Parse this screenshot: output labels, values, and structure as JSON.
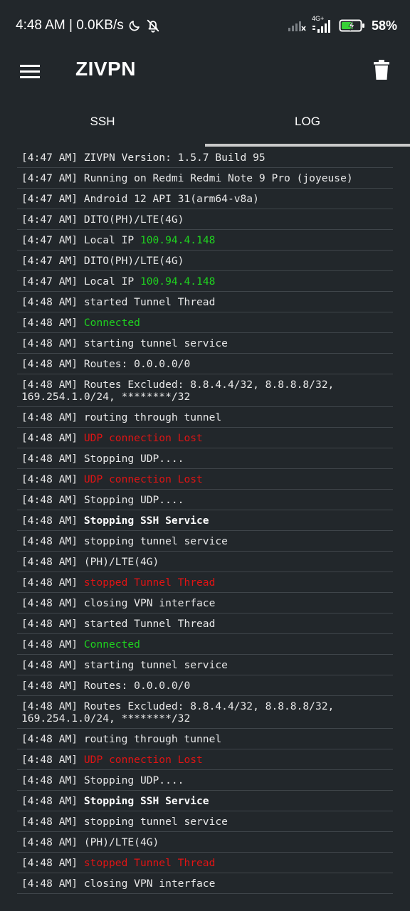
{
  "status_bar": {
    "time_text": "4:48 AM | 0.0KB/s",
    "network_label": "4G+",
    "battery_percent": "58%"
  },
  "toolbar": {
    "title": "ZIVPN"
  },
  "tabs": [
    {
      "label": "SSH",
      "active": false
    },
    {
      "label": "LOG",
      "active": true
    }
  ],
  "colors": {
    "background": "#22272b",
    "green": "#1fd31f",
    "red": "#e01414",
    "divider": "#3f454a"
  },
  "log": [
    {
      "ts": "[4:47 AM]",
      "parts": [
        {
          "t": " ZIVPN Version: 1.5.7 Build 95",
          "s": ""
        }
      ]
    },
    {
      "ts": "[4:47 AM]",
      "parts": [
        {
          "t": " Running on Redmi Redmi Note 9 Pro (joyeuse)",
          "s": ""
        }
      ]
    },
    {
      "ts": "[4:47 AM]",
      "parts": [
        {
          "t": " Android 12 API 31(arm64-v8a)",
          "s": ""
        }
      ]
    },
    {
      "ts": "[4:47 AM]",
      "parts": [
        {
          "t": " DITO(PH)/LTE(4G)",
          "s": ""
        }
      ]
    },
    {
      "ts": "[4:47 AM]",
      "parts": [
        {
          "t": " Local IP ",
          "s": ""
        },
        {
          "t": "100.94.4.148",
          "s": "green"
        }
      ]
    },
    {
      "ts": "[4:47 AM]",
      "parts": [
        {
          "t": " DITO(PH)/LTE(4G)",
          "s": ""
        }
      ]
    },
    {
      "ts": "[4:47 AM]",
      "parts": [
        {
          "t": " Local IP ",
          "s": ""
        },
        {
          "t": "100.94.4.148",
          "s": "green"
        }
      ]
    },
    {
      "ts": "[4:48 AM]",
      "parts": [
        {
          "t": " started Tunnel Thread",
          "s": ""
        }
      ]
    },
    {
      "ts": "[4:48 AM]",
      "parts": [
        {
          "t": " ",
          "s": ""
        },
        {
          "t": "Connected",
          "s": "green"
        }
      ]
    },
    {
      "ts": "[4:48 AM]",
      "parts": [
        {
          "t": " starting tunnel service",
          "s": ""
        }
      ]
    },
    {
      "ts": "[4:48 AM]",
      "parts": [
        {
          "t": " Routes: 0.0.0.0/0",
          "s": ""
        }
      ]
    },
    {
      "ts": "[4:48 AM]",
      "parts": [
        {
          "t": " Routes Excluded: 8.8.4.4/32, 8.8.8.8/32, 169.254.1.0/24, ********/32",
          "s": ""
        }
      ]
    },
    {
      "ts": "[4:48 AM]",
      "parts": [
        {
          "t": " routing through tunnel",
          "s": ""
        }
      ]
    },
    {
      "ts": "[4:48 AM]",
      "parts": [
        {
          "t": " ",
          "s": ""
        },
        {
          "t": "UDP connection Lost",
          "s": "red"
        }
      ]
    },
    {
      "ts": "[4:48 AM]",
      "parts": [
        {
          "t": " Stopping UDP....",
          "s": ""
        }
      ]
    },
    {
      "ts": "[4:48 AM]",
      "parts": [
        {
          "t": " ",
          "s": ""
        },
        {
          "t": "UDP connection Lost",
          "s": "red"
        }
      ]
    },
    {
      "ts": "[4:48 AM]",
      "parts": [
        {
          "t": " Stopping UDP....",
          "s": ""
        }
      ]
    },
    {
      "ts": "[4:48 AM]",
      "parts": [
        {
          "t": " ",
          "s": ""
        },
        {
          "t": "Stopping SSH Service",
          "s": "bold"
        }
      ]
    },
    {
      "ts": "[4:48 AM]",
      "parts": [
        {
          "t": " stopping tunnel service",
          "s": ""
        }
      ]
    },
    {
      "ts": "[4:48 AM]",
      "parts": [
        {
          "t": " (PH)/LTE(4G)",
          "s": ""
        }
      ]
    },
    {
      "ts": "[4:48 AM]",
      "parts": [
        {
          "t": " ",
          "s": ""
        },
        {
          "t": "stopped Tunnel Thread",
          "s": "red"
        }
      ]
    },
    {
      "ts": "[4:48 AM]",
      "parts": [
        {
          "t": " closing VPN interface",
          "s": ""
        }
      ]
    },
    {
      "ts": "[4:48 AM]",
      "parts": [
        {
          "t": " started Tunnel Thread",
          "s": ""
        }
      ]
    },
    {
      "ts": "[4:48 AM]",
      "parts": [
        {
          "t": " ",
          "s": ""
        },
        {
          "t": "Connected",
          "s": "green"
        }
      ]
    },
    {
      "ts": "[4:48 AM]",
      "parts": [
        {
          "t": " starting tunnel service",
          "s": ""
        }
      ]
    },
    {
      "ts": "[4:48 AM]",
      "parts": [
        {
          "t": " Routes: 0.0.0.0/0",
          "s": ""
        }
      ]
    },
    {
      "ts": "[4:48 AM]",
      "parts": [
        {
          "t": " Routes Excluded: 8.8.4.4/32, 8.8.8.8/32, 169.254.1.0/24, ********/32",
          "s": ""
        }
      ]
    },
    {
      "ts": "[4:48 AM]",
      "parts": [
        {
          "t": " routing through tunnel",
          "s": ""
        }
      ]
    },
    {
      "ts": "[4:48 AM]",
      "parts": [
        {
          "t": " ",
          "s": ""
        },
        {
          "t": "UDP connection Lost",
          "s": "red"
        }
      ]
    },
    {
      "ts": "[4:48 AM]",
      "parts": [
        {
          "t": " Stopping UDP....",
          "s": ""
        }
      ]
    },
    {
      "ts": "[4:48 AM]",
      "parts": [
        {
          "t": " ",
          "s": ""
        },
        {
          "t": "Stopping SSH Service",
          "s": "bold"
        }
      ]
    },
    {
      "ts": "[4:48 AM]",
      "parts": [
        {
          "t": " stopping tunnel service",
          "s": ""
        }
      ]
    },
    {
      "ts": "[4:48 AM]",
      "parts": [
        {
          "t": " (PH)/LTE(4G)",
          "s": ""
        }
      ]
    },
    {
      "ts": "[4:48 AM]",
      "parts": [
        {
          "t": " ",
          "s": ""
        },
        {
          "t": "stopped Tunnel Thread",
          "s": "red"
        }
      ]
    },
    {
      "ts": "[4:48 AM]",
      "parts": [
        {
          "t": " closing VPN interface",
          "s": ""
        }
      ]
    }
  ]
}
